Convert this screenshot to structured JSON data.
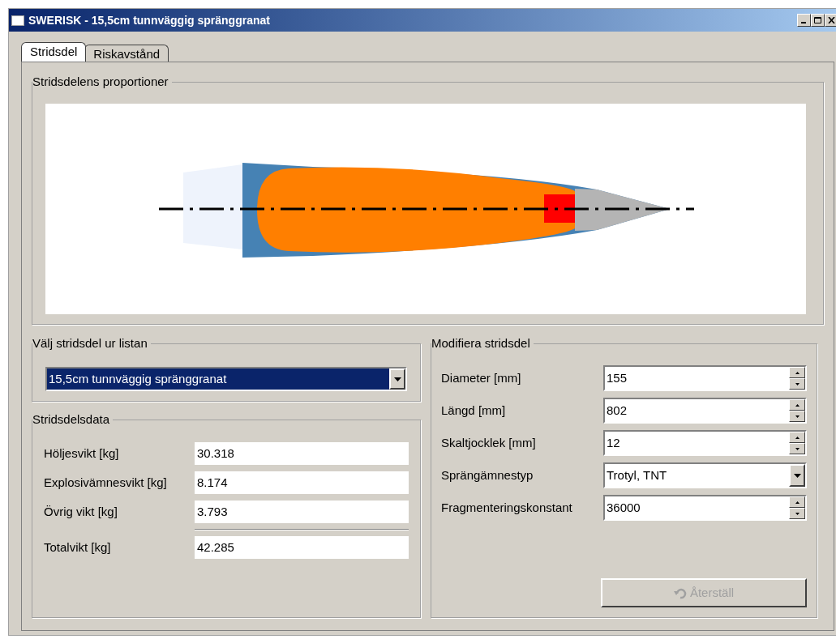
{
  "window": {
    "title": "SWERISK - 15,5cm tunnväggig spränggranat"
  },
  "tabs": [
    {
      "label": "Stridsdel",
      "selected": true
    },
    {
      "label": "Riskavstånd",
      "selected": false
    }
  ],
  "proportions": {
    "title": "Stridsdelens proportioner"
  },
  "selector": {
    "title": "Välj stridsdel ur listan",
    "value": "15,5cm tunnväggig spränggranat"
  },
  "data": {
    "title": "Stridsdelsdata",
    "rows": [
      {
        "label": "Höljesvikt [kg]",
        "value": "30.318"
      },
      {
        "label": "Explosivämnesvikt [kg]",
        "value": "8.174"
      },
      {
        "label": "Övrig vikt [kg]",
        "value": "3.793"
      }
    ],
    "total": {
      "label": "Totalvikt [kg]",
      "value": "42.285"
    }
  },
  "modify": {
    "title": "Modifiera stridsdel",
    "rows": [
      {
        "kind": "spin",
        "label": "Diameter [mm]",
        "value": "155"
      },
      {
        "kind": "spin",
        "label": "Längd [mm]",
        "value": "802"
      },
      {
        "kind": "spin",
        "label": "Skaltjocklek [mm]",
        "value": "12"
      },
      {
        "kind": "combo",
        "label": "Sprängämnestyp",
        "value": "Trotyl, TNT"
      },
      {
        "kind": "spin",
        "label": "Fragmenteringskonstant",
        "value": "36000"
      }
    ],
    "reset": {
      "label": "Återställ",
      "disabled": true
    }
  }
}
